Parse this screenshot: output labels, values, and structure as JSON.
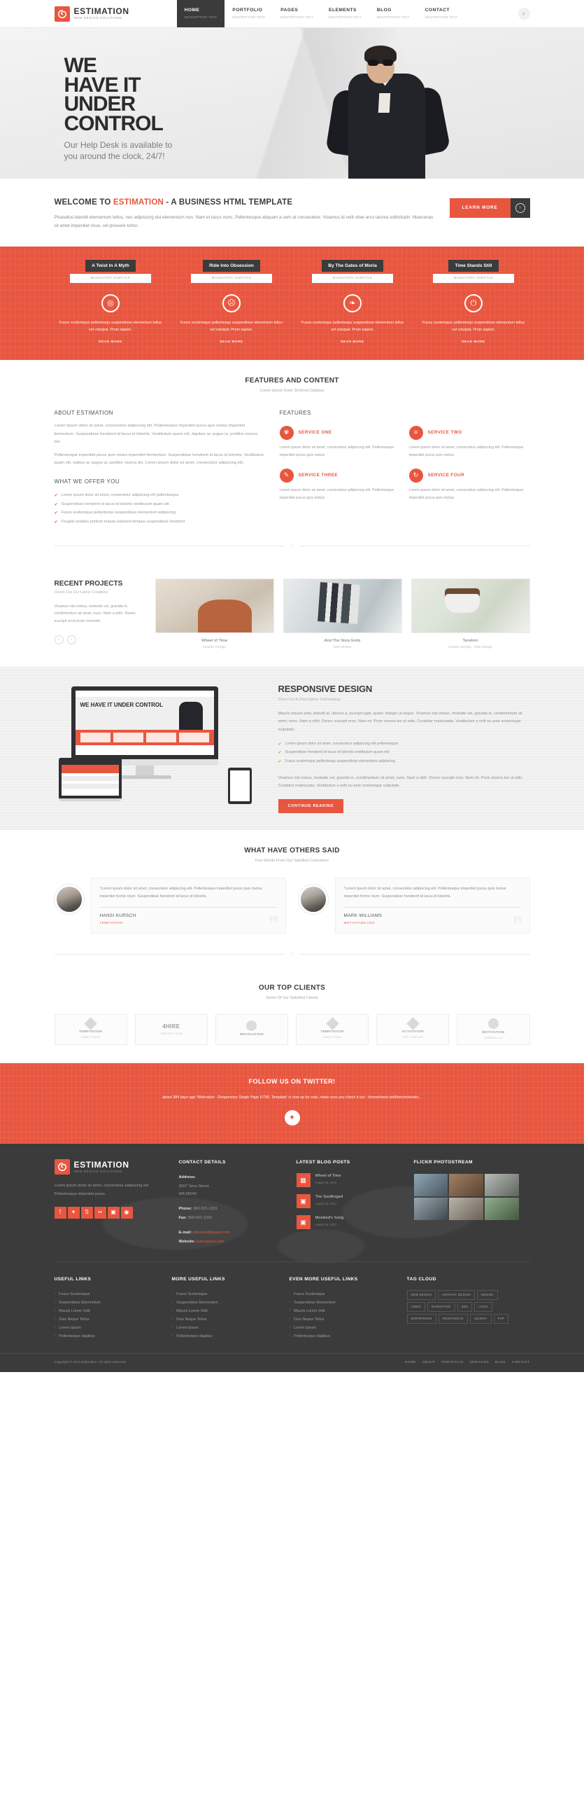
{
  "header": {
    "logo": {
      "name": "ESTIMATION",
      "tagline": "NEW DESIGN SOLUTIONS",
      "icon": "spiral-icon"
    },
    "nav": [
      {
        "label": "HOME",
        "sub": "DESCRIPTION TEXT",
        "active": true
      },
      {
        "label": "PORTFOLIO",
        "sub": "DESCRIPTION TEXT",
        "active": false
      },
      {
        "label": "PAGES",
        "sub": "DESCRIPTION TEXT",
        "active": false
      },
      {
        "label": "ELEMENTS",
        "sub": "DESCRIPTION TEXT",
        "active": false
      },
      {
        "label": "BLOG",
        "sub": "DESCRIPTION TEXT",
        "active": false
      },
      {
        "label": "CONTACT",
        "sub": "DESCRIPTION TEXT",
        "active": false
      }
    ],
    "search_icon": "search-icon"
  },
  "hero": {
    "line1": "WE",
    "line2": "HAVE IT",
    "line3": "UNDER",
    "line4": "CONTROL",
    "sub1": "Our Help Desk is available to",
    "sub2": "you around the clock, 24/7!"
  },
  "welcome": {
    "title_pre": "WELCOME TO ",
    "title_hl": "ESTIMATION",
    "title_post": " - A BUSINESS HTML TEMPLATE",
    "body": "Phasellus blandit elementum tellus, nec adipiscing dui elementum non. Nam et lacus nunc. Pellentesque aliquam a sem at consectetur. Vivamus id velit vitae arcu lacinia sollicitudin. Maecenas sit amet imperdiet risus, vel posuere tortor.",
    "button": "LEARN MORE",
    "button_icon": "chevron-right-icon"
  },
  "services_red": {
    "columns": [
      {
        "title": "A Twist In A Myth",
        "subtitle": "MANDATORY SUBTITLE",
        "icon": "compass-icon",
        "text": "Fusce scelerisque pellentesqu suspendisse elementum tellus vel volutpat. Proin sapien.",
        "more": "READ MORE"
      },
      {
        "title": "Ride Into Obsession",
        "subtitle": "MANDATORY SUBTITLE",
        "icon": "alien-icon",
        "text": "Fusce scelerisque pellentesqu suspendisse elementum tellus vel volutpat. Proin sapien.",
        "more": "READ MORE"
      },
      {
        "title": "By The Gates of Moria",
        "subtitle": "MANDATORY SUBTITLE",
        "icon": "leaf-icon",
        "text": "Fusce scelerisque pellentesqu suspendisse elementum tellus vel volutpat. Proin sapien.",
        "more": "READ MORE"
      },
      {
        "title": "Time Stands Still",
        "subtitle": "MANDATORY SUBTITLE",
        "icon": "power-icon",
        "text": "Fusce scelerisque pellentesqu suspendisse elementum tellus vel volutpat. Proin sapien.",
        "more": "READ MORE"
      }
    ]
  },
  "features": {
    "heading": "FEATURES AND CONTENT",
    "subheading": "Lorem Ipsum Dolor Sit Amet Dabipus",
    "about_title": "ABOUT ESTIMATION",
    "about_p1": "Lorem ipsum dolor sit amet, consectetur adipiscing elit. Pellentesque imperdiet purus quis metus imperdiet fermentum. Suspendisse hendrerit id lacus id lobortis. Vestibulum quam elit, dapibus ac augue ut, porttitor viverra dui.",
    "about_p2": "Pellentesque imperdiet purus quis metus imperdiet fermentum. Suspendisse hendrerit id lacus id lobortis. Vestibulum quam elit, epibus ac augue ut, porttitor viverra dui. Lorem ipsum dolor sit amet, consectetur adipiscing elit.",
    "offer_title": "WHAT WE OFFER YOU",
    "offer_items": [
      "Lorem ipsum dolor sit amet, consectetur adipiscing elit pellentesque",
      "Suspendisse hendrerit id lacus id lobortis vestibulum quam elit",
      "Fusce scelerisque pellentesqu suspendisse elementum adipiscing",
      "Feugiat sodales pretium massa euismod tempus suspendisse hendrerit"
    ],
    "features_title": "FEATURES",
    "services": [
      {
        "name": "SERVICE ONE",
        "icon": "gear-icon",
        "text": "Lorem ipsum dolor sit amet, consectetur adipiscing elit. Pellentesque imperdiet purus quis metus"
      },
      {
        "name": "SERVICE TWO",
        "icon": "list-icon",
        "text": "Lorem ipsum dolor sit amet, consectetur adipiscing elit. Pellentesque imperdiet purus quis metus"
      },
      {
        "name": "SERVICE THREE",
        "icon": "pencil-icon",
        "text": "Lorem ipsum dolor sit amet, consectetur adipiscing elit. Pellentesque imperdiet purus quis metus"
      },
      {
        "name": "SERVICE FOUR",
        "icon": "refresh-icon",
        "text": "Lorem ipsum dolor sit amet, consectetur adipiscing elit. Pellentesque imperdiet purus quis metus"
      }
    ]
  },
  "projects": {
    "heading": "RECENT PROJECTS",
    "subheading": "Check Out Our Latest Creations",
    "body": "Vivamus nisi metus, molestie vel, gravida in, condimentum sit amet, nunc. Nam a nibh. Donec suscipit erod proin viverodo.",
    "prev_icon": "chevron-left-icon",
    "next_icon": "chevron-right-icon",
    "items": [
      {
        "title": "Wheel of Time",
        "category": "Graphic Design"
      },
      {
        "title": "And The Story Ends",
        "category": "Web Design"
      },
      {
        "title": "Tanelorn",
        "category": "Graphic Design - Web Design"
      }
    ]
  },
  "responsive": {
    "heading": "RESPONSIVE DESIGN",
    "subheading": "Place For A Descriptive Subheading",
    "body1": "Mauris mauris ante, blandit et, ultrices a, suscipit eget, quam. Integer ut neque. Vivamus nisi metus, molestie vel, gravida in, condimentum sit amet, nunc. Nam a nibh. Donec suscipit eros. Nam mi. Proin viverra leo ut odio. Curabitur malesuada. Vestibulum a velit eu ante scelerisque vulputate.",
    "list": [
      "Lorem ipsum dolor sit amet, consectetur adipiscing elit pellentesque",
      "Suspendisse hendrerit id lacus id lobortis vestibulum quam elit",
      "Fusce scelerisque pellentesqu suspendisse elementum adipiscing"
    ],
    "body2": "Vivamus nisi metus, molestie vel, gravida in, condimentum sit amet, nunc. Nam a nibh. Donec suscipit eros. Nam mi. Proin viverra leo ut odio. Curabitur malesuada. Vestibulum a velit eu ante scelerisque vulputate.",
    "button": "CONTINUE READING",
    "mock_headline": "WE HAVE IT UNDER CONTROL"
  },
  "testimonials": {
    "heading": "WHAT HAVE OTHERS SAID",
    "subheading": "Few Words From Our Satisfied Customers",
    "items": [
      {
        "quote": "\"Lorem ipsum dolor sit amet, consectetur adipiscing elit. Pellentesque imperdiet purus quis metus imperdiet ferme ntum. Suspendisse hendrerit id lacus id lobortis.",
        "name": "HANSI KURSCH",
        "role": "TEMPTATION"
      },
      {
        "quote": "\"Lorem ipsum dolor sit amet, consectetur adipiscing elit. Pellentesque imperdiet purus quis metus imperdiet ferme ntum. Suspendisse hendrerit id lacus id lobortis.",
        "name": "MARK WILLIAMS",
        "role": "MOTIVATION CEO"
      }
    ]
  },
  "clients": {
    "heading": "OUR TOP CLIENTS",
    "subheading": "Some Of Our Satisfied Clients",
    "items": [
      {
        "name": "TEMPTATION",
        "sub": "STABLE THEME",
        "style": "diamond"
      },
      {
        "name": "4HIRE",
        "sub": "TEMPLATE THEME",
        "style": "big"
      },
      {
        "name": "REVOLUTION",
        "sub": "",
        "style": "circle"
      },
      {
        "name": "TEMPTATION",
        "sub": "STABLE THEME",
        "style": "diamond"
      },
      {
        "name": "ACTIVATION",
        "sub": "HTML TEMPLATE",
        "style": "diamond"
      },
      {
        "name": "MOTIVATION",
        "sub": "UPDATED v 1.0",
        "style": "circle"
      }
    ]
  },
  "twitter": {
    "heading": "FOLLOW US ON TWITTER!",
    "tweet": "about 384 days ago 'Motivation - Responsive Single Page HTML Template' is now up for sale, make sure you check it out - themeforest.net/item/motivatio...",
    "icon": "twitter-icon"
  },
  "footer": {
    "logo": {
      "name": "ESTIMATION",
      "tagline": "NEW DESIGN SOLUTIONS"
    },
    "about": "Lorem ipsum dolor sit amet, consectetur adipiscing elit. Pellentesque imperdiet purus",
    "socials": [
      "facebook-icon",
      "twitter-icon",
      "skype-icon",
      "flickr-icon",
      "instagram-icon",
      "dribbble-icon"
    ],
    "contact_title": "CONTACT DETAILS",
    "address_label": "Address:",
    "address_1": "3607 Terra Street",
    "address_2": "WA 98240",
    "phone_label": "Phone:",
    "phone": "360-321-1231",
    "fax_label": "Fax:",
    "fax": "360-421-1231",
    "email_label": "E-mail:",
    "email": "johndoe@ipsum.com",
    "website_label": "Website:",
    "website": "www.ipsum.com",
    "blog_title": "LATEST BLOG POSTS",
    "blog_posts": [
      {
        "title": "Wheel of Time",
        "date": "August 18, 2013",
        "icon": "film-icon"
      },
      {
        "title": "The Soulforged",
        "date": "August 18, 2013",
        "icon": "image-icon"
      },
      {
        "title": "Mordred's Song",
        "date": "August 18, 2013",
        "icon": "image-icon"
      }
    ],
    "flickr_title": "FLICKR PHOTOSTREAM",
    "link_columns": [
      {
        "title": "USEFUL LINKS",
        "items": [
          "Fusce Scelerisque",
          "Suspendisse Elementum",
          "Mauris Lorem Velit",
          "Duis Neque Tellus",
          "Lorem Ipsum",
          "Pellentesque dapibus"
        ]
      },
      {
        "title": "MORE USEFUL LINKS",
        "items": [
          "Fusce Scelerisque",
          "Suspendisse Elementum",
          "Mauris Lorem Velit",
          "Duis Neque Tellus",
          "Lorem Ipsum",
          "Pellentesque dapibus"
        ]
      },
      {
        "title": "EVEN MORE USEFUL LINKS",
        "items": [
          "Fusce Scelerisque",
          "Suspendisse Elementum",
          "Mauris Lorem Velit",
          "Duis Neque Tellus",
          "Lorem Ipsum",
          "Pellentesque dapibus"
        ]
      }
    ],
    "tag_title": "TAG CLOUD",
    "tags": [
      "WEB DESIGN",
      "GRAPHIC DESIGN",
      "DESIGN",
      "VIDEO",
      "MARKETING",
      "SEO",
      "LOGO",
      "WORDPRESS",
      "RESPONSIVE",
      "JQUERY",
      "PHP"
    ],
    "copyright": "Copyright © 2014 Estimation. All rights reserved.",
    "bottom_links": [
      "HOME",
      "ABOUT",
      "PORTFOLIO",
      "SERVICES",
      "BLOG",
      "CONTACT"
    ]
  },
  "colors": {
    "accent": "#e8563f",
    "dark": "#3b3b3b",
    "green": "#7ac142"
  }
}
